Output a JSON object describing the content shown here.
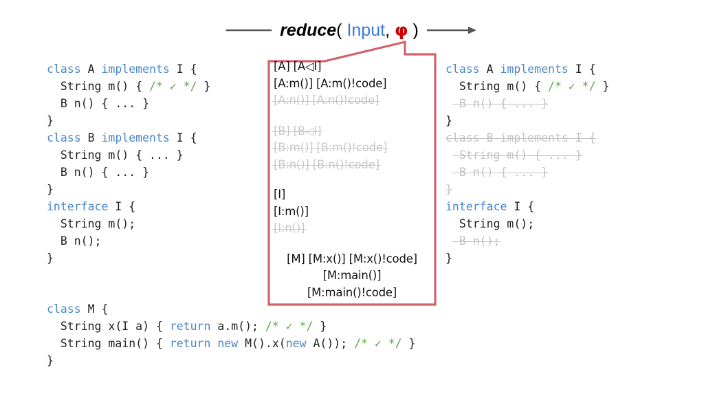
{
  "header": {
    "prefix_arrow": "line-segment",
    "suffix_arrow": "arrow-right",
    "function_name": "reduce",
    "open_paren": "(",
    "arg1": "Input",
    "comma": ",",
    "arg2": "φ",
    "close_paren": ")",
    "colors": {
      "arg1": "#3c78d8",
      "arg2": "#cc0000",
      "arrow": "#555555"
    }
  },
  "callout": {
    "border_color": "#d4606a",
    "dim_color": "#c8c8c8",
    "groups": [
      {
        "lines": [
          {
            "text": "[A] [A◁I]",
            "dim": false
          },
          {
            "text": "[A:m()] [A:m()!code]",
            "dim": false
          },
          {
            "text": "[A:n()] [A:n()!code]",
            "dim": true
          }
        ]
      },
      {
        "lines": [
          {
            "text": "[B] [B◁I]",
            "dim": true
          },
          {
            "text": "[B:m()] [B:m()!code]",
            "dim": true
          },
          {
            "text": "[B:n()] [B:n()!code]",
            "dim": true
          }
        ]
      },
      {
        "lines": [
          {
            "text": "[I]",
            "dim": false
          },
          {
            "text": "[I:m()]",
            "dim": false
          },
          {
            "text": "[I:n()]",
            "dim": true
          }
        ]
      },
      {
        "centered": true,
        "lines": [
          {
            "text": "[M] [M:x()] [M:x()!code]",
            "dim": false
          },
          {
            "text": "[M:main()]",
            "dim": false
          },
          {
            "text": "[M:main()!code]",
            "dim": false
          }
        ]
      }
    ]
  },
  "code_left": {
    "title": "input-program",
    "lines": [
      [
        {
          "t": "class ",
          "c": "kw"
        },
        {
          "t": "A ",
          "c": "plain"
        },
        {
          "t": "implements ",
          "c": "kw"
        },
        {
          "t": "I {",
          "c": "plain"
        }
      ],
      [
        {
          "t": "  String m() { ",
          "c": "plain"
        },
        {
          "t": "/* ✓ */",
          "c": "cmt"
        },
        {
          "t": " }",
          "c": "plain"
        }
      ],
      [
        {
          "t": "  B n() { ... }",
          "c": "plain"
        }
      ],
      [
        {
          "t": "}",
          "c": "plain"
        }
      ],
      [
        {
          "t": "class ",
          "c": "kw"
        },
        {
          "t": "B ",
          "c": "plain"
        },
        {
          "t": "implements ",
          "c": "kw"
        },
        {
          "t": "I {",
          "c": "plain"
        }
      ],
      [
        {
          "t": "  String m() { ... }",
          "c": "plain"
        }
      ],
      [
        {
          "t": "  B n() { ... }",
          "c": "plain"
        }
      ],
      [
        {
          "t": "}",
          "c": "plain"
        }
      ],
      [
        {
          "t": "interface ",
          "c": "kw"
        },
        {
          "t": "I {",
          "c": "plain"
        }
      ],
      [
        {
          "t": "  String m();",
          "c": "plain"
        }
      ],
      [
        {
          "t": "  B n();",
          "c": "plain"
        }
      ],
      [
        {
          "t": "}",
          "c": "plain"
        }
      ]
    ]
  },
  "code_left_main": {
    "title": "main-class",
    "lines": [
      [
        {
          "t": "class ",
          "c": "kw"
        },
        {
          "t": "M {",
          "c": "plain"
        }
      ],
      [
        {
          "t": "  String x(I a) { ",
          "c": "plain"
        },
        {
          "t": "return ",
          "c": "kw"
        },
        {
          "t": "a.m(); ",
          "c": "plain"
        },
        {
          "t": "/* ✓ */",
          "c": "cmt"
        },
        {
          "t": " }",
          "c": "plain"
        }
      ],
      [
        {
          "t": "  String main() { ",
          "c": "plain"
        },
        {
          "t": "return new ",
          "c": "kw"
        },
        {
          "t": "M().x(",
          "c": "plain"
        },
        {
          "t": "new ",
          "c": "kw"
        },
        {
          "t": "A()); ",
          "c": "plain"
        },
        {
          "t": "/* ✓ */",
          "c": "cmt"
        },
        {
          "t": " }",
          "c": "plain"
        }
      ],
      [
        {
          "t": "}",
          "c": "plain"
        }
      ]
    ]
  },
  "code_right": {
    "title": "reduced-program",
    "lines": [
      {
        "dim": false,
        "strike": false,
        "parts": [
          {
            "t": "class ",
            "c": "kw"
          },
          {
            "t": "A ",
            "c": "plain"
          },
          {
            "t": "implements ",
            "c": "kw"
          },
          {
            "t": "I {",
            "c": "plain"
          }
        ]
      },
      {
        "dim": false,
        "strike": false,
        "parts": [
          {
            "t": "  String m() { ",
            "c": "plain"
          },
          {
            "t": "/* ✓ */",
            "c": "cmt"
          },
          {
            "t": " }",
            "c": "plain"
          }
        ]
      },
      {
        "dim": true,
        "strike": true,
        "indent": true,
        "parts": [
          {
            "t": "B n() { ... }",
            "c": "plain"
          }
        ]
      },
      {
        "dim": false,
        "strike": false,
        "parts": [
          {
            "t": "}",
            "c": "plain"
          }
        ]
      },
      {
        "dim": true,
        "strike": true,
        "parts": [
          {
            "t": "class B implements I {",
            "c": "plain"
          }
        ]
      },
      {
        "dim": true,
        "strike": true,
        "indent": true,
        "parts": [
          {
            "t": "String m() { ... }",
            "c": "plain"
          }
        ]
      },
      {
        "dim": true,
        "strike": true,
        "indent": true,
        "parts": [
          {
            "t": "B n() { ... }",
            "c": "plain"
          }
        ]
      },
      {
        "dim": true,
        "strike": true,
        "parts": [
          {
            "t": "}",
            "c": "plain"
          }
        ]
      },
      {
        "dim": false,
        "strike": false,
        "parts": [
          {
            "t": "interface ",
            "c": "kw"
          },
          {
            "t": "I {",
            "c": "plain"
          }
        ]
      },
      {
        "dim": false,
        "strike": false,
        "parts": [
          {
            "t": "  String m();",
            "c": "plain"
          }
        ]
      },
      {
        "dim": true,
        "strike": true,
        "indent": true,
        "parts": [
          {
            "t": "B n();",
            "c": "plain"
          }
        ]
      },
      {
        "dim": false,
        "strike": false,
        "parts": [
          {
            "t": "}",
            "c": "plain"
          }
        ]
      }
    ]
  }
}
